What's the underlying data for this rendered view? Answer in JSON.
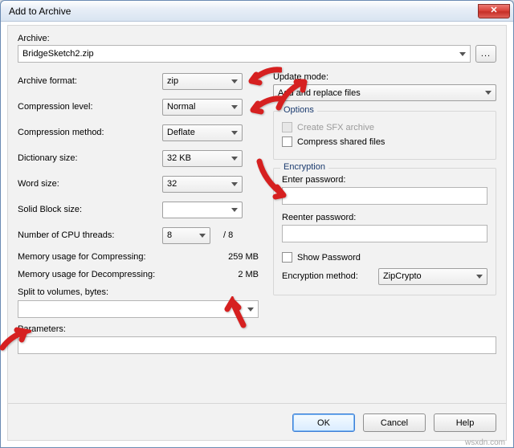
{
  "window": {
    "title": "Add to Archive"
  },
  "archive": {
    "label": "Archive:",
    "value": "BridgeSketch2.zip",
    "browse": "..."
  },
  "left": {
    "format_label": "Archive format:",
    "format_value": "zip",
    "level_label": "Compression level:",
    "level_value": "Normal",
    "method_label": "Compression method:",
    "method_value": "Deflate",
    "dict_label": "Dictionary size:",
    "dict_value": "32 KB",
    "word_label": "Word size:",
    "word_value": "32",
    "block_label": "Solid Block size:",
    "block_value": "",
    "cpu_label": "Number of CPU threads:",
    "cpu_value": "8",
    "cpu_total": "/ 8",
    "mem_comp_label": "Memory usage for Compressing:",
    "mem_comp_value": "259 MB",
    "mem_decomp_label": "Memory usage for Decompressing:",
    "mem_decomp_value": "2 MB",
    "split_label": "Split to volumes, bytes:",
    "params_label": "Parameters:"
  },
  "right": {
    "update_label": "Update mode:",
    "update_value": "Add and replace files",
    "options_title": "Options",
    "opt_sfx": "Create SFX archive",
    "opt_share": "Compress shared files",
    "enc_title": "Encryption",
    "enter_pw": "Enter password:",
    "reenter_pw": "Reenter password:",
    "show_pw": "Show Password",
    "enc_method_label": "Encryption method:",
    "enc_method_value": "ZipCrypto"
  },
  "buttons": {
    "ok": "OK",
    "cancel": "Cancel",
    "help": "Help"
  },
  "watermark": "wsxdn.com"
}
